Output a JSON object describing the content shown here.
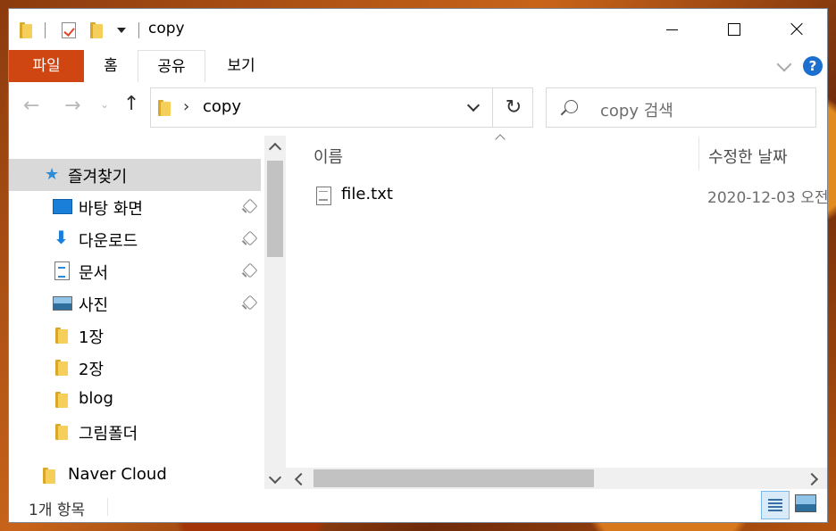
{
  "window": {
    "title": "copy"
  },
  "ribbon": {
    "tabs": {
      "file": "파일",
      "home": "홈",
      "share": "공유",
      "view": "보기"
    },
    "help": "?"
  },
  "address": {
    "path": "copy"
  },
  "search": {
    "placeholder": "copy 검색"
  },
  "sidebar": {
    "quick_access": "즐겨찾기",
    "items": [
      "바탕 화면",
      "다운로드",
      "문서",
      "사진",
      "1장",
      "2장",
      "blog",
      "그림폴더"
    ],
    "cloud": "Naver Cloud"
  },
  "columns": {
    "name": "이름",
    "date": "수정한 날짜"
  },
  "files": [
    {
      "name": "file.txt",
      "date": "2020-12-03 오전"
    }
  ],
  "status": {
    "count": "1개 항목"
  },
  "colors": {
    "file_tab": "#d04613",
    "selected": "#d9d9d9",
    "accent": "#1a7fd8"
  }
}
